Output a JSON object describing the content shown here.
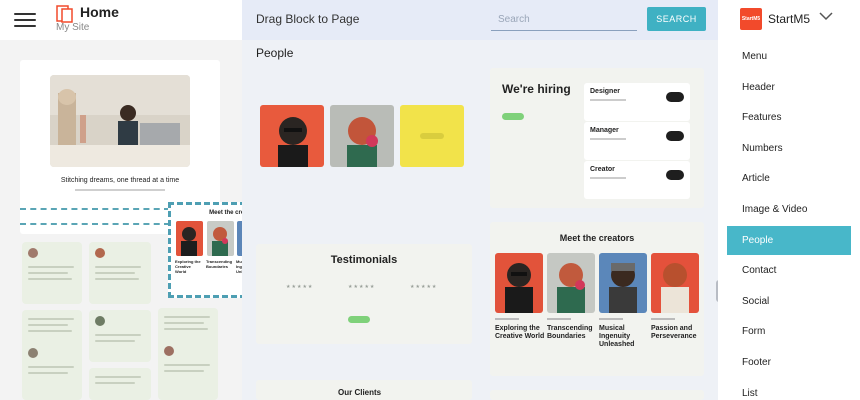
{
  "header": {
    "site_title": "Home",
    "site_subtitle": "My Site",
    "center_title": "Drag Block to Page",
    "search_placeholder": "Search",
    "search_button": "SEARCH",
    "brand_logo_text": "StartM5",
    "brand_name": "StartM5"
  },
  "preview": {
    "hero_caption": "Stitching dreams, one thread at a time",
    "dragged_block_title": "Meet the creators",
    "dragged_captions": [
      "Exploring the Creative World",
      "Transcending Boundaries",
      "Musical Ingenuity Unleashed",
      "Passion and Perseverance"
    ]
  },
  "gallery": {
    "section_title": "People",
    "hiring": {
      "title": "We're hiring",
      "jobs": [
        "Designer",
        "Manager",
        "Creator"
      ]
    },
    "testimonials_title": "Testimonials",
    "meet_creators": {
      "title": "Meet the creators",
      "captions": [
        "Exploring the Creative World",
        "Transcending Boundaries",
        "Musical Ingenuity Unleashed",
        "Passion and Perseverance"
      ]
    },
    "clients_title": "Our Clients"
  },
  "block_list": {
    "items": [
      "Menu",
      "Header",
      "Features",
      "Numbers",
      "Article",
      "Image & Video",
      "People",
      "Contact",
      "Social",
      "Form",
      "Footer",
      "List"
    ],
    "active": "People"
  },
  "colors": {
    "accent": "#48b7c9",
    "search_button": "#3fb1c3",
    "brand": "#f24a2b"
  }
}
